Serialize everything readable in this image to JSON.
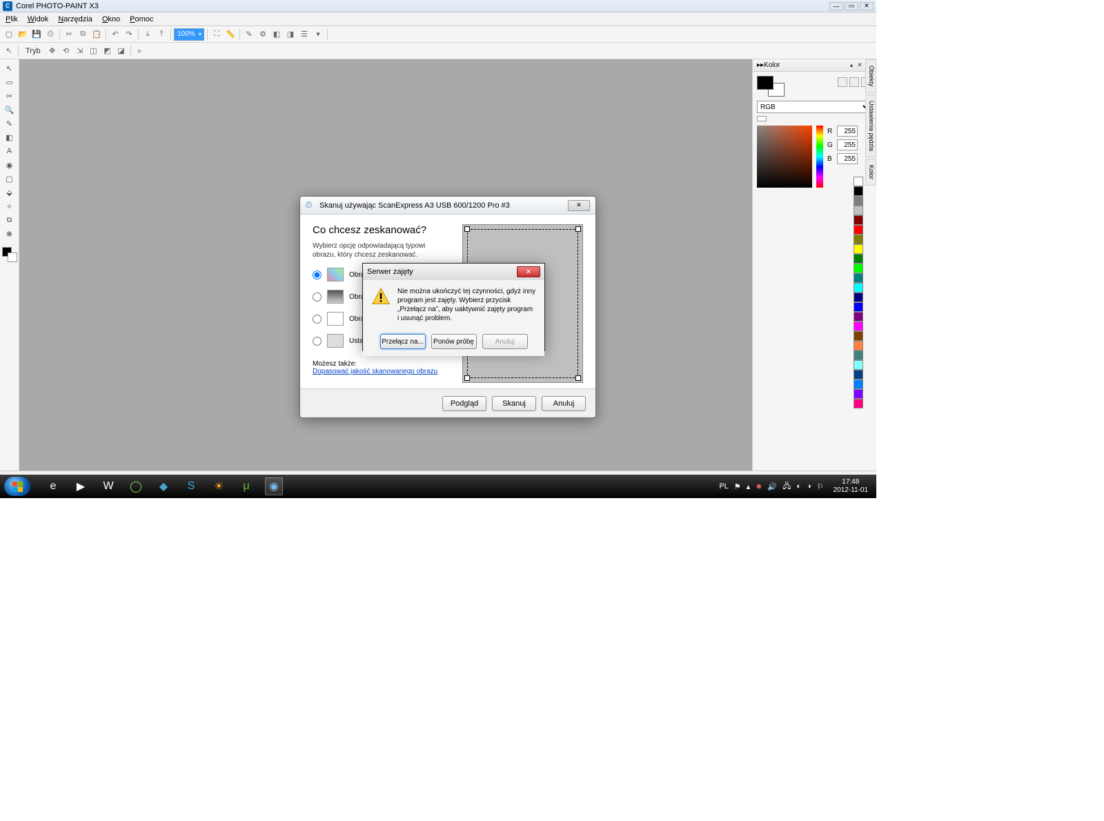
{
  "app": {
    "title": "Corel PHOTO-PAINT X3",
    "titlebar_logo": "C"
  },
  "menu": {
    "items": [
      "Plik",
      "Widok",
      "Narzędzia",
      "Okno",
      "Pomoc"
    ]
  },
  "toolbar1": {
    "zoom_value": "100%"
  },
  "toolbar2": {
    "mode_label": "Tryb"
  },
  "color_panel": {
    "title": "Kolor",
    "model": "RGB",
    "r_label": "R",
    "r": "255",
    "g_label": "G",
    "g": "255",
    "b_label": "B",
    "b": "255"
  },
  "side_tabs": [
    "Obiekty",
    "Ustawienia pędzla",
    "Kolor"
  ],
  "palette": [
    "#ffffff",
    "#000000",
    "#7f7f7f",
    "#c0c0c0",
    "#800000",
    "#ff0000",
    "#808000",
    "#ffff00",
    "#008000",
    "#00ff00",
    "#008080",
    "#00ffff",
    "#000080",
    "#0000ff",
    "#800080",
    "#ff00ff",
    "#804000",
    "#ff8040",
    "#408080",
    "#80ffff",
    "#004080",
    "#0080ff",
    "#8000ff",
    "#ff0080"
  ],
  "scan_dialog": {
    "title": "Skanuj używając ScanExpress A3 USB 600/1200 Pro #3",
    "heading": "Co chcesz zeskanować?",
    "hint": "Wybierz opcję odpowiadającą typowi obrazu, który chcesz zeskanować.",
    "opt1": "Obraz kolorowy",
    "opt2": "Obraz w skali szarości",
    "opt3": "Obraz czarno-biały",
    "opt4": "Ustawienia niestandardowe",
    "also_label": "Możesz także:",
    "also_link": "Dopasować jakość skanowanego obrazu",
    "btn_preview": "Podgląd",
    "btn_scan": "Skanuj",
    "btn_cancel": "Anuluj"
  },
  "busy_dialog": {
    "title": "Serwer zajęty",
    "message": "Nie można ukończyć tej czynności, gdyż inny program jest zajęty. Wybierz przycisk „Przełącz na”, aby uaktywnić zajęty program i usunąć problem.",
    "btn_switch": "Przełącz na...",
    "btn_retry": "Ponów próbę",
    "btn_cancel": "Anuluj"
  },
  "taskbar": {
    "lang": "PL",
    "time": "17:48",
    "date": "2012-11-01"
  }
}
